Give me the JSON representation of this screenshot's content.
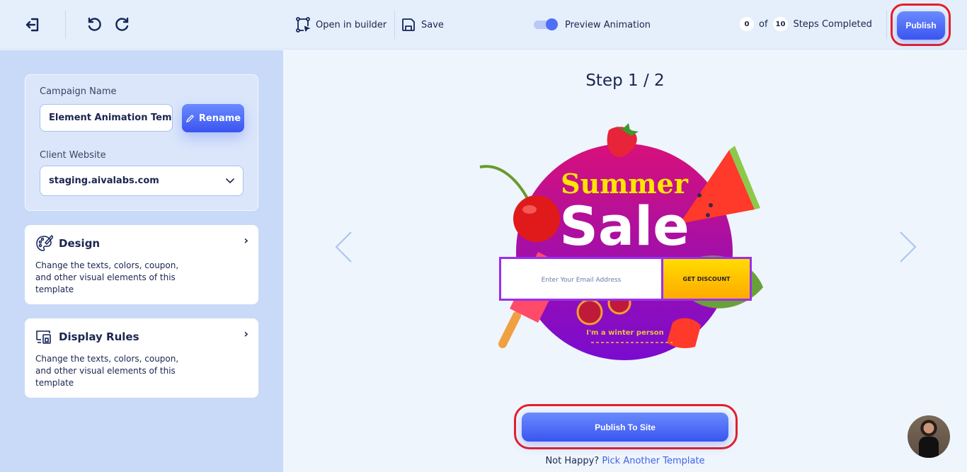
{
  "topbar": {
    "exit_icon": "exit-icon",
    "undo_icon": "undo-icon",
    "redo_icon": "redo-icon",
    "open_builder_label": "Open in builder",
    "save_label": "Save",
    "preview_label": "Preview Animation",
    "preview_enabled": true,
    "steps_done": "0",
    "of_label": "of",
    "steps_total": "10",
    "steps_label": "Steps Completed",
    "publish_label": "Publish"
  },
  "sidebar": {
    "campaign_label": "Campaign Name",
    "campaign_value": "Element Animation Temp",
    "rename_label": "Rename",
    "website_label": "Client Website",
    "website_value": "staging.aivalabs.com",
    "cards": [
      {
        "title": "Design",
        "desc": "Change the texts, colors, coupon, and other visual elements of this template",
        "icon": "palette-icon"
      },
      {
        "title": "Display Rules",
        "desc": "Change the texts, colors, coupon, and other visual elements of this template",
        "icon": "devices-icon"
      }
    ]
  },
  "main": {
    "step_title": "Step 1 / 2",
    "popup": {
      "headline_top": "Summer",
      "headline_main": "Sale",
      "email_placeholder": "Enter Your Email Address",
      "cta_label": "GET DISCOUNT",
      "decline_label": "I'm a winter person"
    },
    "publish_site_label": "Publish To Site",
    "not_happy_label": "Not Happy?",
    "pick_template_label": "Pick Another Template"
  },
  "colors": {
    "accent": "#4d6ef5",
    "highlight": "#e3202a",
    "popup_purple": "#8a18c8",
    "popup_yellow": "#ffd200"
  }
}
